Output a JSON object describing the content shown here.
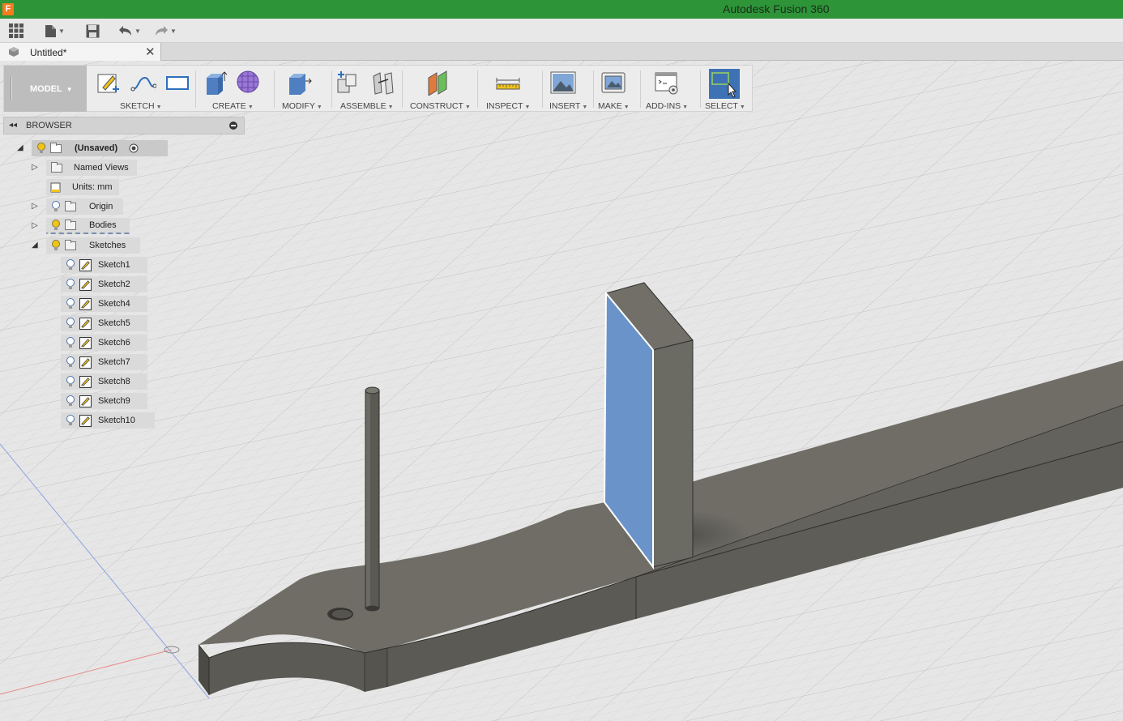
{
  "app": {
    "title": "Autodesk Fusion 360",
    "icon_letter": "F"
  },
  "document": {
    "tab_label": "Untitled*",
    "close_glyph": "✕"
  },
  "toolbar": {
    "workspace": "MODEL",
    "groups": {
      "sketch": "SKETCH",
      "create": "CREATE",
      "modify": "MODIFY",
      "assemble": "ASSEMBLE",
      "construct": "CONSTRUCT",
      "inspect": "INSPECT",
      "insert": "INSERT",
      "make": "MAKE",
      "addins": "ADD-INS",
      "select": "SELECT"
    }
  },
  "browser": {
    "title": "BROWSER",
    "root": "(Unsaved)",
    "named_views": "Named Views",
    "units": "Units: mm",
    "origin": "Origin",
    "bodies": "Bodies",
    "sketches": "Sketches",
    "sketch_items": [
      "Sketch1",
      "Sketch2",
      "Sketch4",
      "Sketch5",
      "Sketch6",
      "Sketch7",
      "Sketch8",
      "Sketch9",
      "Sketch10"
    ]
  },
  "colors": {
    "title_bar": "#2e9438",
    "selected_face": "#6a93c9",
    "body": "#6b6a62",
    "bulb": "#f0c419"
  }
}
